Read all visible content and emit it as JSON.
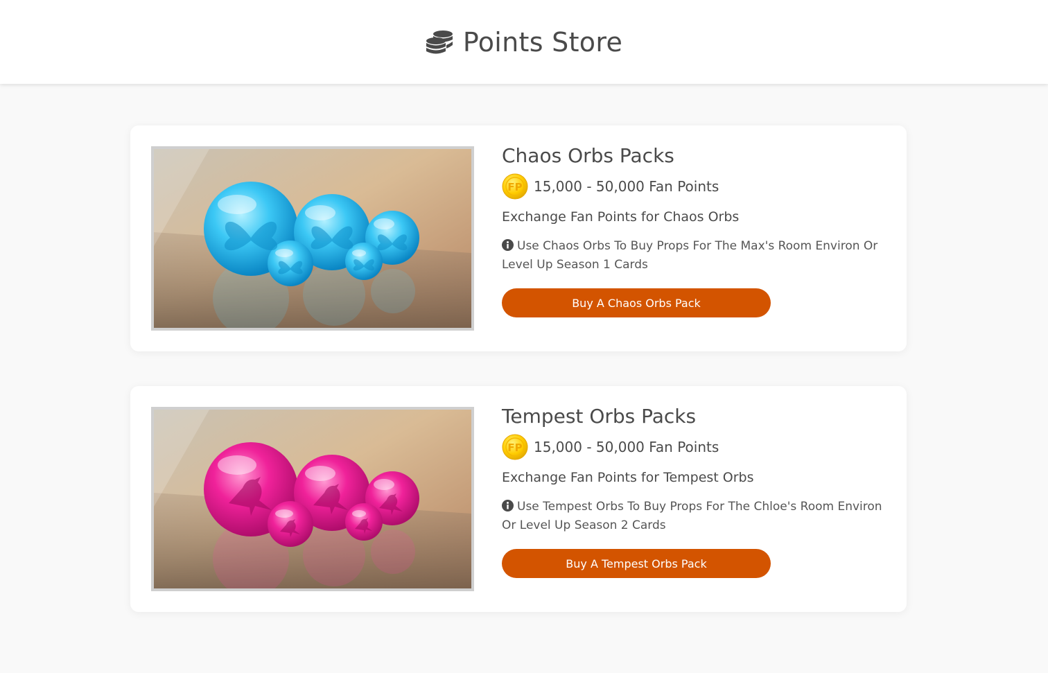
{
  "header": {
    "title": "Points Store",
    "icon": "coins-icon"
  },
  "packs": [
    {
      "title": "Chaos Orbs Packs",
      "price": "15,000 - 50,000 Fan Points",
      "coin_label": "FP",
      "description": "Exchange Fan Points for Chaos Orbs",
      "note": "Use Chaos Orbs To Buy Props For The Max's Room Environ Or Level Up Season 1 Cards",
      "button": "Buy A Chaos Orbs Pack",
      "orb_color": "#29b6f6",
      "orb_symbol": "butterfly"
    },
    {
      "title": "Tempest Orbs Packs",
      "price": "15,000 - 50,000 Fan Points",
      "coin_label": "FP",
      "description": "Exchange Fan Points for Tempest Orbs",
      "note": "Use Tempest Orbs To Buy Props For The Chloe's Room Environ Or Level Up Season 2 Cards",
      "button": "Buy A Tempest Orbs Pack",
      "orb_color": "#ec1a8c",
      "orb_symbol": "raven"
    }
  ],
  "colors": {
    "accent": "#d35400",
    "text": "#4a4a4a",
    "background": "#f9f9f9",
    "coin": "#ffcc00"
  }
}
